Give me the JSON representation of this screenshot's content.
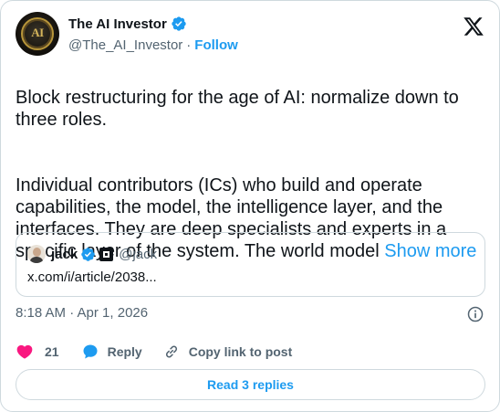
{
  "author": {
    "display_name": "The AI Investor",
    "handle": "@The_AI_Investor",
    "separator": "·",
    "follow_label": "Follow",
    "avatar_text": "AI",
    "verified_color": "#1d9bf0"
  },
  "tweet": {
    "paragraph1": "Block restructuring for the age of AI: normalize down to three roles.",
    "paragraph2": "Individual contributors (ICs) who build and operate capabilities, the model, the intelligence layer, and the interfaces. They are deep specialists and experts in a specific layer of the system. The world model",
    "show_more_label": "Show more"
  },
  "quote": {
    "display_name": "jack",
    "handle": "@jack",
    "link_text": "x.com/i/article/2038..."
  },
  "timestamp": "8:18 AM · Apr 1, 2026",
  "actions": {
    "like_count": "21",
    "reply_label": "Reply",
    "copy_label": "Copy link to post"
  },
  "replies_button": "Read 3 replies",
  "colors": {
    "accent": "#1d9bf0",
    "like": "#f91880",
    "text": "#0f1419",
    "muted": "#536471",
    "border": "#cfd9de"
  },
  "icons": [
    "verified-badge-icon",
    "x-logo-icon",
    "info-icon",
    "heart-icon",
    "reply-bubble-icon",
    "link-icon"
  ]
}
